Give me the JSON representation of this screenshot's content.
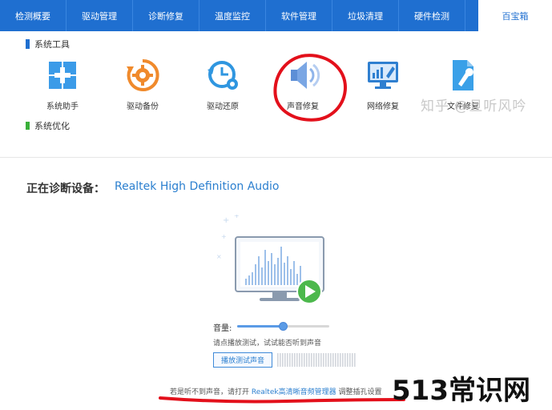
{
  "tabs": [
    {
      "label": "检测概要"
    },
    {
      "label": "驱动管理"
    },
    {
      "label": "诊断修复"
    },
    {
      "label": "温度监控"
    },
    {
      "label": "软件管理"
    },
    {
      "label": "垃圾清理"
    },
    {
      "label": "硬件检测"
    },
    {
      "label": "百宝箱",
      "active": true
    }
  ],
  "toolbox": {
    "section_title": "系统工具",
    "section2_title": "系统优化",
    "tools": [
      {
        "label": "系统助手",
        "icon": "windows-plus-icon"
      },
      {
        "label": "驱动备份",
        "icon": "gear-refresh-icon"
      },
      {
        "label": "驱动还原",
        "icon": "clock-restore-icon"
      },
      {
        "label": "声音修复",
        "icon": "speaker-icon"
      },
      {
        "label": "网络修复",
        "icon": "monitor-wrench-icon"
      },
      {
        "label": "文件修复",
        "icon": "file-wrench-icon"
      }
    ]
  },
  "watermark_top": "知乎 @旦听风吟",
  "diagnosis": {
    "title": "正在诊断设备：",
    "device": "Realtek High Definition Audio",
    "volume_label": "音量:",
    "volume_level": 0.5,
    "hint": "请点播放测试，试试能否听到声音",
    "play_button": "播放测试声音",
    "bottom_prefix": "若是听不到声音，请打开",
    "bottom_link": "Realtek高清晰音频管理器",
    "bottom_suffix": "调整插孔设置"
  },
  "watermark_big": "513常识网",
  "colors": {
    "tabbar": "#1f6fd0",
    "accent_blue": "#2b7fcf",
    "annotation_red": "#e3101b",
    "play_green": "#4cb84c"
  }
}
